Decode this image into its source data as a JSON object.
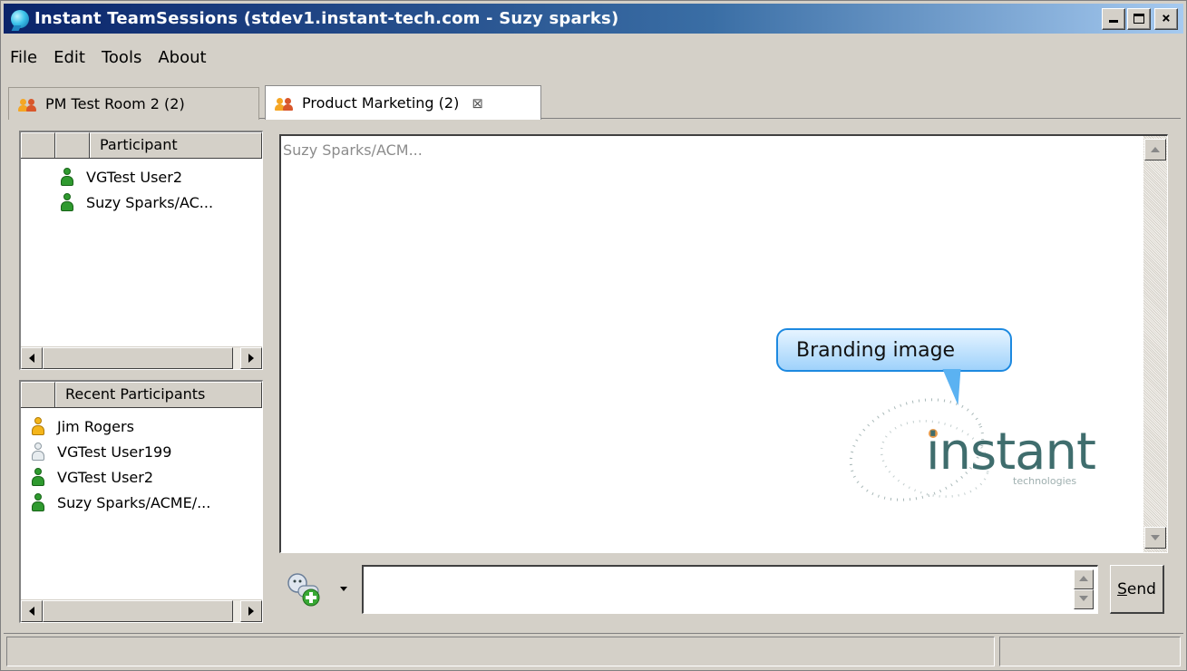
{
  "window": {
    "title": "Instant TeamSessions (stdev1.instant-tech.com - Suzy sparks)",
    "buttons": [
      "minimize",
      "maximize",
      "close"
    ]
  },
  "menu": {
    "items": [
      "File",
      "Edit",
      "Tools",
      "About"
    ]
  },
  "tabs": [
    {
      "label": "PM Test Room 2 (2)",
      "active": false,
      "closable": false
    },
    {
      "label": "Product Marketing (2)",
      "active": true,
      "closable": true
    }
  ],
  "participants": {
    "header": "Participant",
    "items": [
      {
        "name": "VGTest User2",
        "status": "online"
      },
      {
        "name": "Suzy Sparks/AC...",
        "status": "online"
      }
    ]
  },
  "recent": {
    "header": "Recent Participants",
    "items": [
      {
        "name": "Jim Rogers",
        "status": "away"
      },
      {
        "name": "VGTest User199",
        "status": "offline"
      },
      {
        "name": "VGTest User2",
        "status": "online"
      },
      {
        "name": "Suzy Sparks/ACME/...",
        "status": "online"
      }
    ]
  },
  "transcript": {
    "text": "Suzy Sparks/ACM..."
  },
  "branding": {
    "callout": "Branding image",
    "logo_word": "instant",
    "logo_sub": "technologies"
  },
  "input": {
    "value": "",
    "send_label": "Send"
  },
  "colors": {
    "titlebar_start": "#0a246a",
    "titlebar_end": "#a6caf0",
    "online": "#2f9a2f",
    "away": "#f4b51a",
    "offline": "#e7ecef",
    "brand_text": "#3f6d6d"
  },
  "icons": {
    "app": "chat-bubble-icon",
    "room": "people-group-icon",
    "emoticon": "emoticon-add-icon"
  }
}
